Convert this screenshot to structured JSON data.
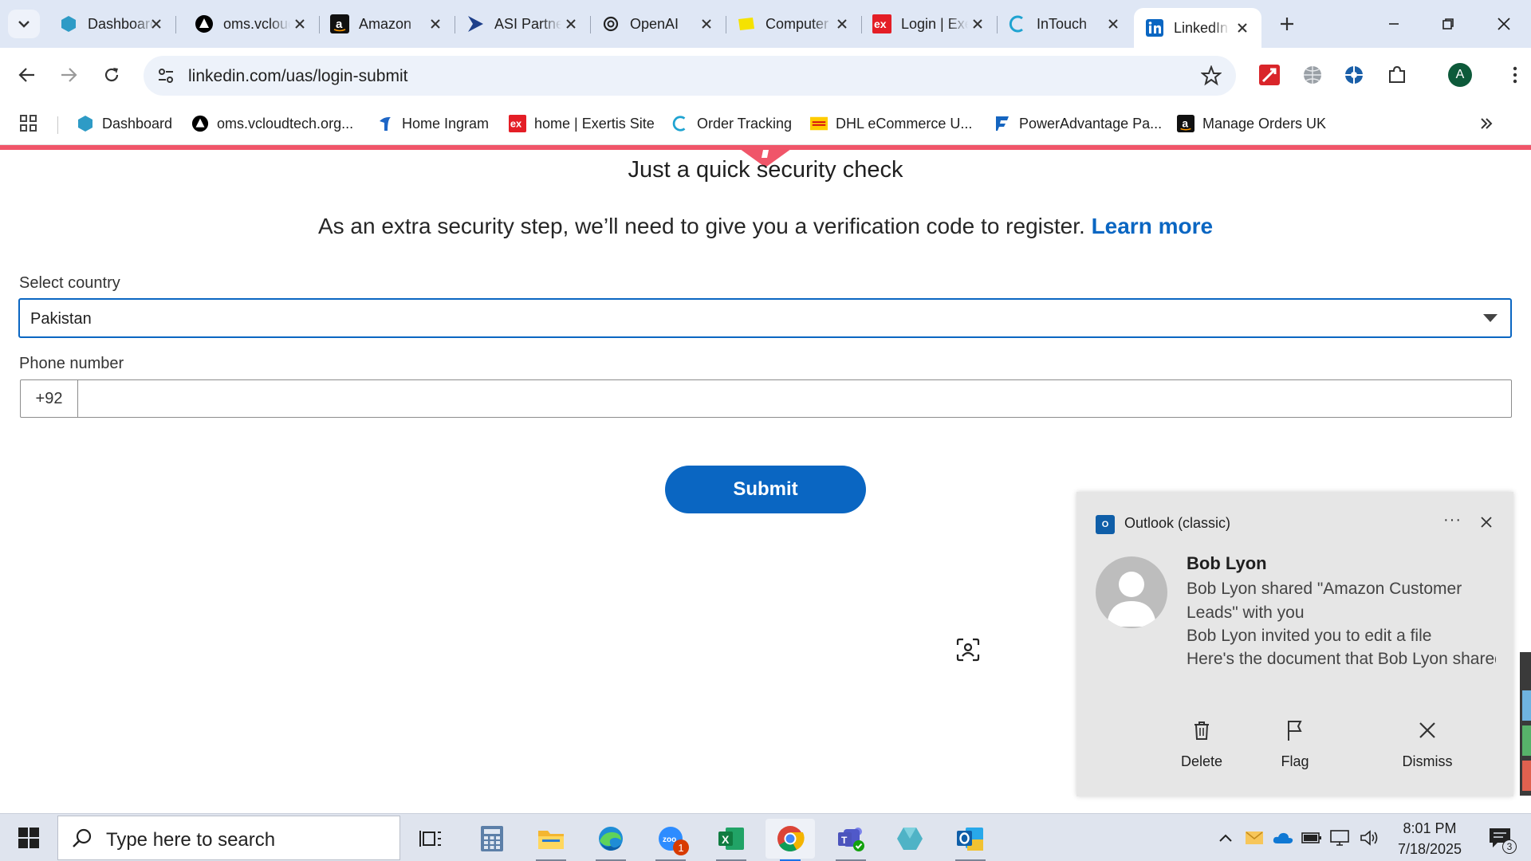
{
  "browser": {
    "tabs": [
      {
        "title": "Dashboard",
        "icon": "hexagon-icon",
        "color": "#2e86c1"
      },
      {
        "title": "oms.vcloudtech.org",
        "icon": "triangle-logo-icon",
        "color": "#000000"
      },
      {
        "title": "Amazon",
        "icon": "amazon-icon",
        "color": "#000000"
      },
      {
        "title": "ASI Partner",
        "icon": "arrow-play-icon",
        "color": "#1d3f8a"
      },
      {
        "title": "OpenAI",
        "icon": "openai-icon",
        "color": "#222222"
      },
      {
        "title": "Computer",
        "icon": "yellow-note-icon",
        "color": "#f5e200"
      },
      {
        "title": "Login | Exertis",
        "icon": "exertis-icon",
        "color": "#e41e26"
      },
      {
        "title": "InTouch",
        "icon": "intouch-icon",
        "color": "#1fa3d1"
      },
      {
        "title": "LinkedIn",
        "icon": "linkedin-icon",
        "color": "#0a66c2",
        "active": true
      }
    ],
    "url": "linkedin.com/uas/login-submit",
    "profile_initial": "A",
    "bookmarks": [
      {
        "label": "Dashboard",
        "icon": "hexagon-icon"
      },
      {
        "label": "oms.vcloudtech.org...",
        "icon": "triangle-logo-icon"
      },
      {
        "label": "Home Ingram",
        "icon": "ingram-icon"
      },
      {
        "label": "home | Exertis Site",
        "icon": "exertis-icon"
      },
      {
        "label": "Order Tracking",
        "icon": "intouch-icon"
      },
      {
        "label": "DHL eCommerce U...",
        "icon": "dhl-icon"
      },
      {
        "label": "PowerAdvantage Pa...",
        "icon": "poweradvantage-icon"
      },
      {
        "label": "Manage Orders UK",
        "icon": "amazon-icon"
      }
    ]
  },
  "page": {
    "heading": "Just a quick security check",
    "subtext": "As an extra security step, we’ll need to give you a verification code to register.",
    "learn_more": "Learn more",
    "country_label": "Select country",
    "country_value": "Pakistan",
    "phone_label": "Phone number",
    "phone_code": "+92",
    "phone_value": "",
    "submit_label": "Submit",
    "accent": "#0a66c2"
  },
  "notification": {
    "app": "Outlook (classic)",
    "more": "···",
    "sender": "Bob Lyon",
    "lines": [
      "Bob Lyon shared \"Amazon Customer",
      "Leads\" with you",
      "Bob Lyon invited you to edit a file",
      "Here's the document that Bob Lyon shared with you."
    ],
    "actions": [
      {
        "label": "Delete",
        "icon": "trash-icon"
      },
      {
        "label": "Flag",
        "icon": "flag-icon"
      },
      {
        "label": "Dismiss",
        "icon": "close-icon"
      }
    ]
  },
  "taskbar": {
    "search_placeholder": "Type here to search",
    "zoom_badge": "1",
    "time": "8:01 PM",
    "date": "7/18/2025",
    "notification_count": "3"
  }
}
